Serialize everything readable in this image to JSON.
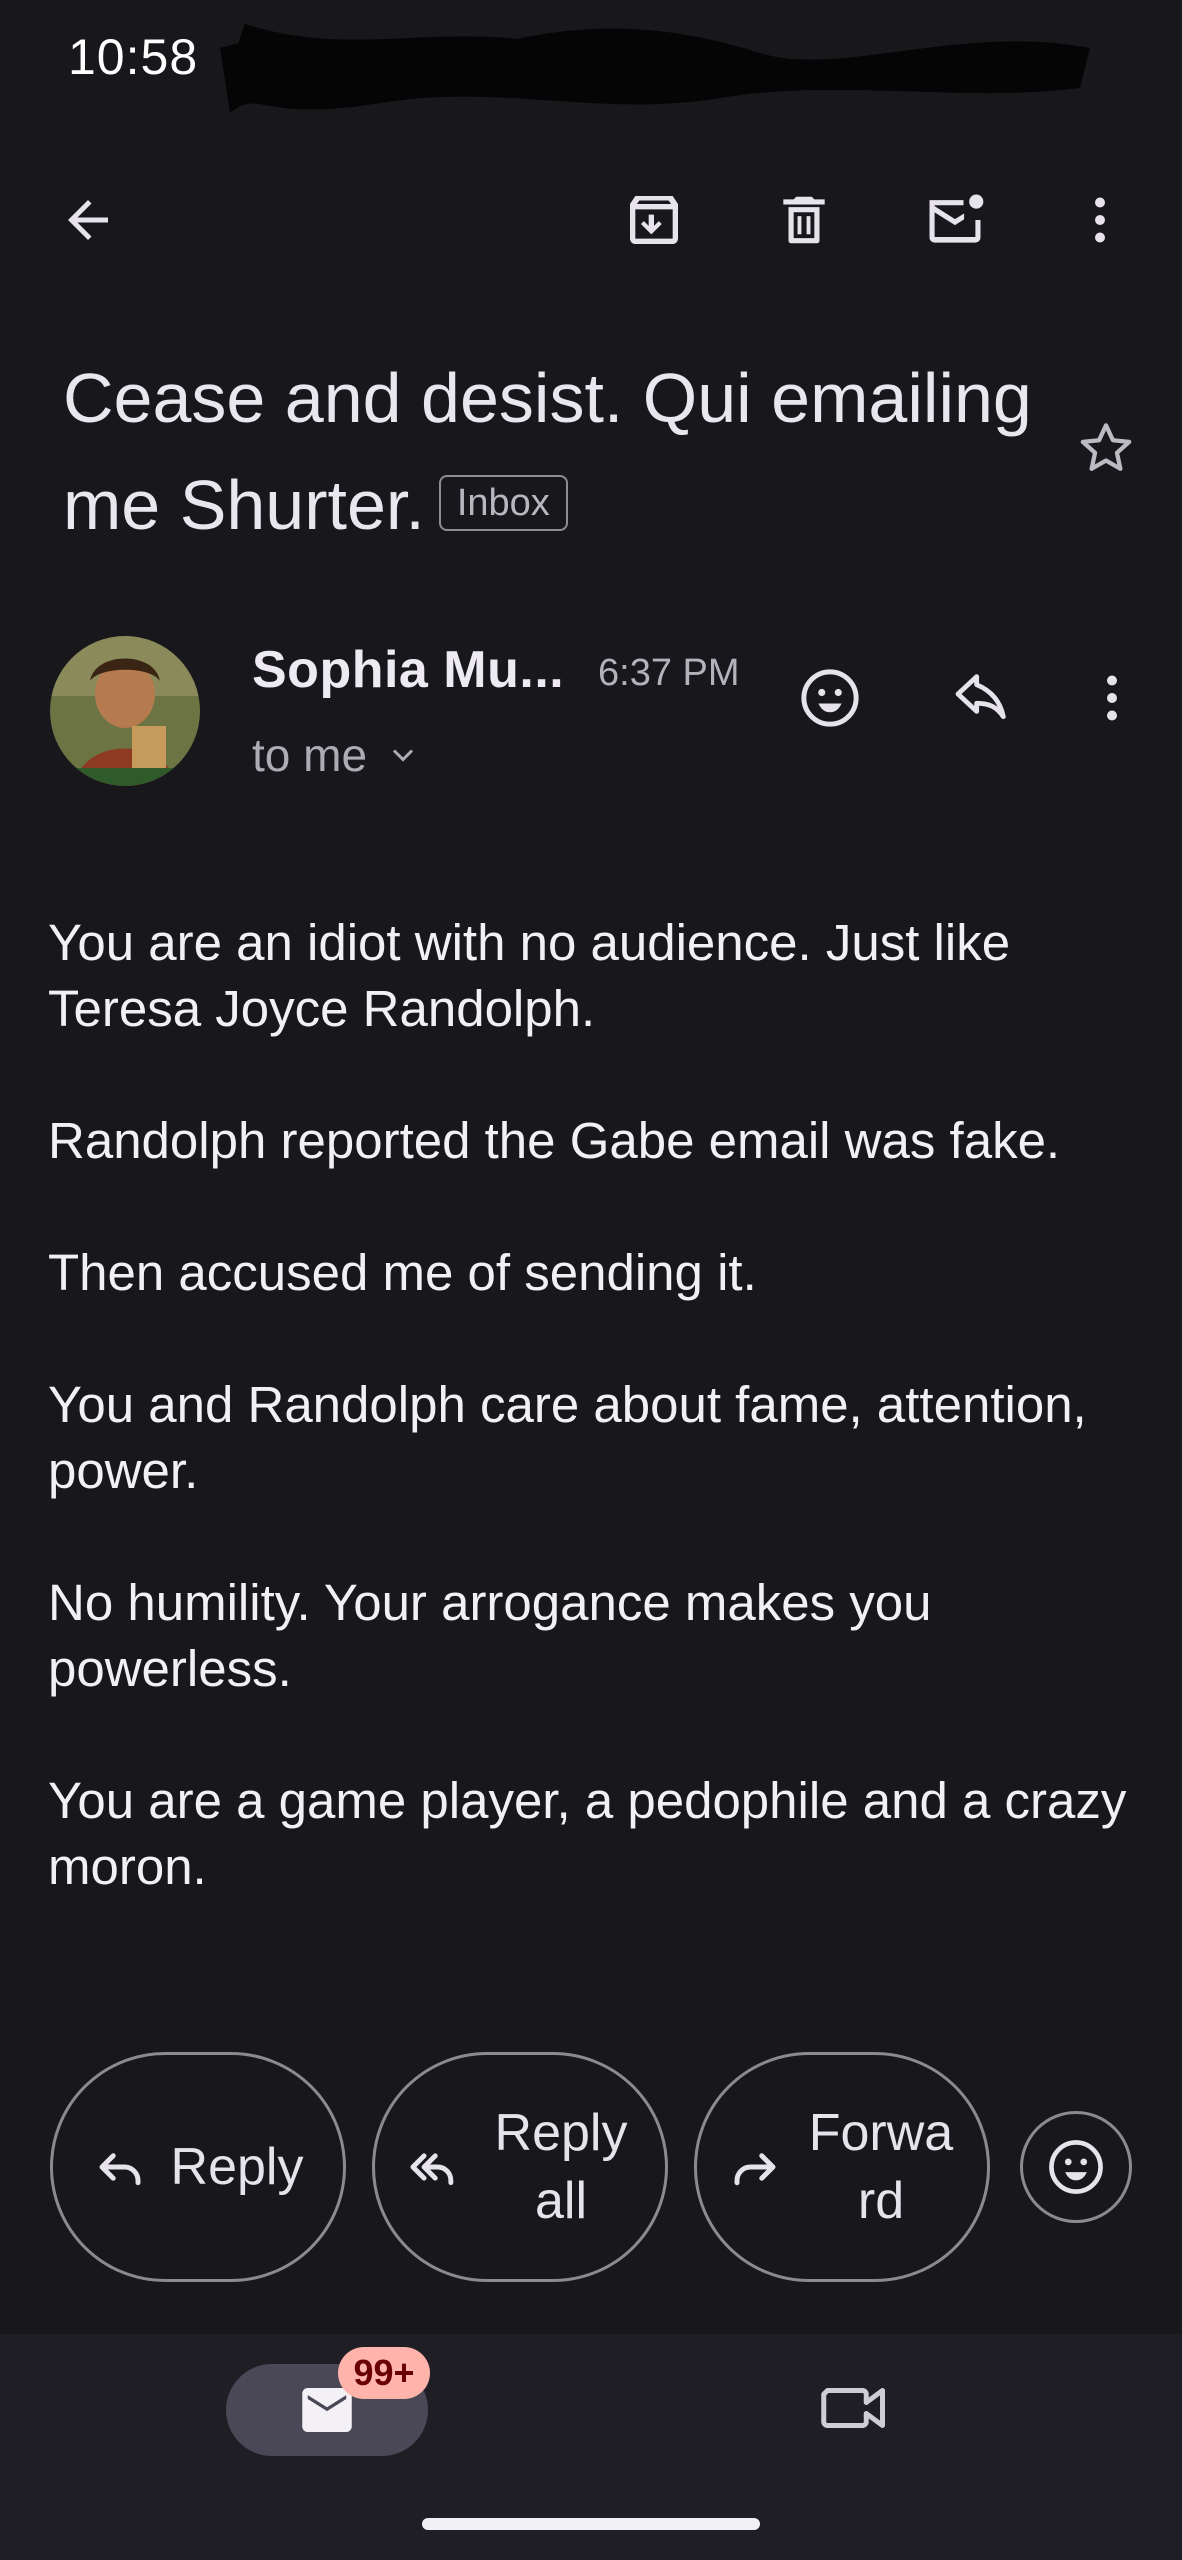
{
  "status_bar": {
    "time": "10:58"
  },
  "toolbar": {
    "icons": [
      "back-arrow-icon",
      "archive-icon",
      "delete-icon",
      "mark-unread-icon",
      "more-vert-icon"
    ]
  },
  "subject": {
    "title": "Cease and desist. Qui emailing me Shurter.",
    "label_chip": "Inbox"
  },
  "message_header": {
    "sender_name": "Sophia Mu...",
    "time": "6:37 PM",
    "recipient": "to me"
  },
  "body": {
    "paragraphs": [
      "You are an idiot with no audience. Just like Teresa Joyce Randolph.",
      "Randolph reported the Gabe email was fake.",
      "Then accused me of sending it.",
      "You and Randolph care about fame, attention, power.",
      "No humility. Your arrogance makes you powerless.",
      "You are a game player, a pedophile and a crazy moron."
    ]
  },
  "actions": {
    "reply_label": "Reply",
    "reply_all_label": "Reply all",
    "forward_label": "Forward"
  },
  "bottom_nav": {
    "mail_badge": "99+",
    "tabs": [
      "mail-icon",
      "video-camera-icon"
    ]
  },
  "colors": {
    "background": "#18171c",
    "bottom_bar": "#1f1e25",
    "badge": "#ffb4ab",
    "active_tab": "#4a4757"
  }
}
